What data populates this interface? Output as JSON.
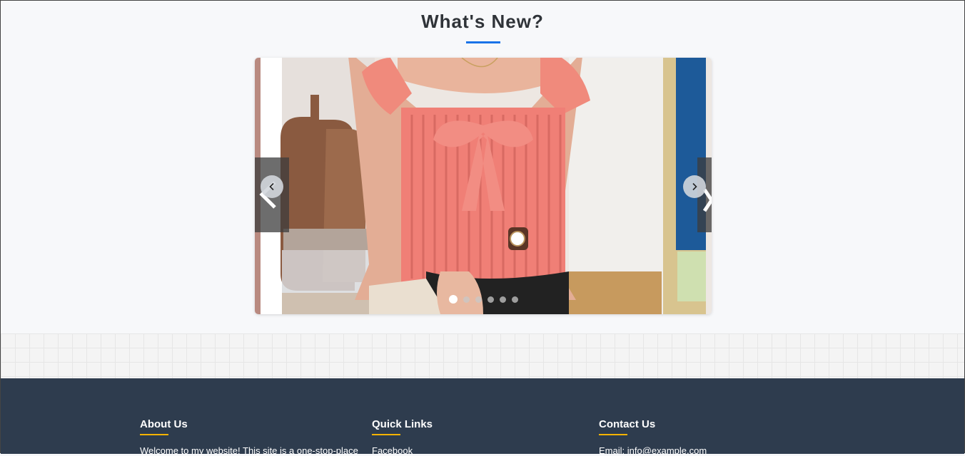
{
  "section": {
    "title": "What's New?"
  },
  "carousel": {
    "prev_label": "Previous slide",
    "next_label": "Next slide",
    "slide_count": 6,
    "active_slide": 1
  },
  "footer": {
    "about": {
      "title": "About Us",
      "text": "Welcome to my website! This site is a one-stop-place"
    },
    "quick_links": {
      "title": "Quick Links",
      "items": [
        "Facebook"
      ]
    },
    "contact": {
      "title": "Contact Us",
      "email_line": "Email: info@example.com"
    }
  },
  "colors": {
    "accent_blue": "#1a73e8",
    "footer_bg": "#2e3c4e",
    "footer_accent": "#f5b301",
    "top_color": "#f07f76"
  }
}
